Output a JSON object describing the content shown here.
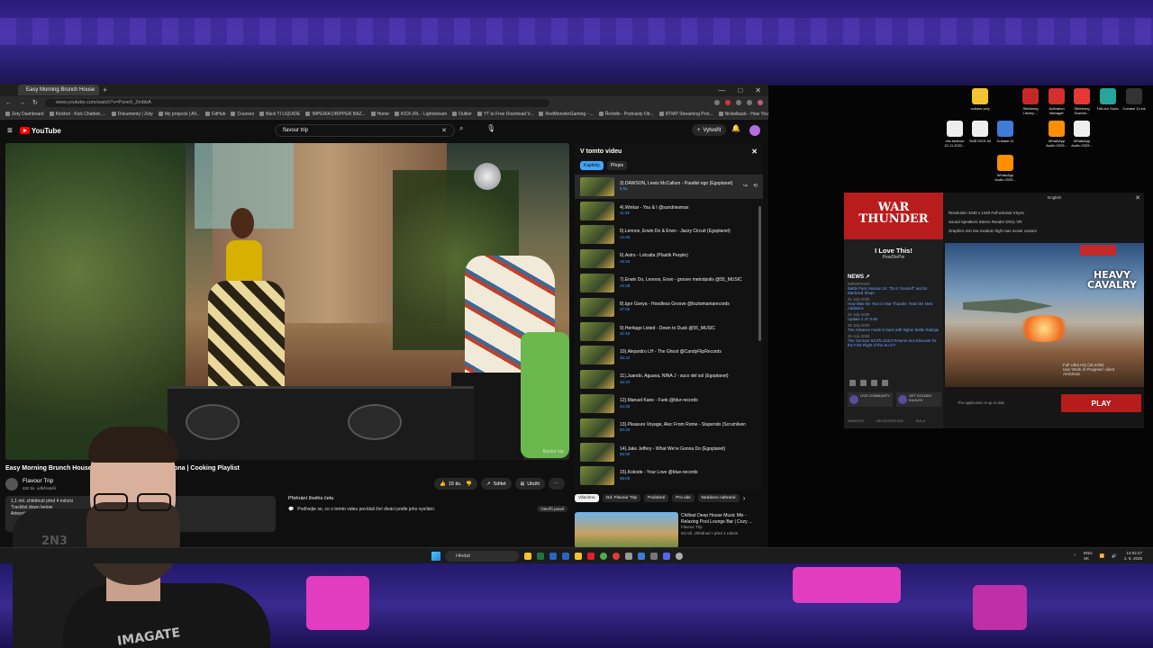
{
  "browser": {
    "tab_title": "Easy Morning Brunch House",
    "url": "www.youtube.com/watch?v=Psne9_ZmbbA",
    "bookmarks": [
      "Zety Dashboard",
      "Kickbot - Kick Chatbot, ...",
      "Dokumenty | Zety",
      "My projects | All...",
      "GitHub",
      "Courses",
      "Bäck TI LIQUIDE",
      "IMPERIA DRIPPER BAZ...",
      "Home",
      "KICK.IRL - Lightstream",
      "Outlier",
      "YT to Free Download V...",
      "RedMonsterGaming - ...",
      "Řešidlo - Podcasty Ob...",
      "RTMP Streaming Prot...",
      "Nickelback - How You ...",
      "Other Bookmarks"
    ]
  },
  "youtube": {
    "logo_text": "YouTube",
    "search_value": "flavour trip",
    "create_label": "Vytvořit",
    "video_title": "Easy Morning Brunch House Mix | Latin DJ Set In Barcelona | Cooking Playlist",
    "watermark": "flavour trip",
    "channel_name": "Flavour Trip",
    "channel_subs": "462 tis. odběratelů",
    "like_count": "15 tis.",
    "share_label": "Sdílet",
    "save_label": "Uložit",
    "description_line1": "1,1 mil. zhlédnutí  před 4 měsíci",
    "description_line2": "Tracklist down below",
    "description_line3": "Artwork...",
    "live_chat_title": "Přehrání živého četu",
    "live_chat_text": "Podívejte se, co o tomto videu povídali živí diváci podle jeho vysílání.",
    "live_chat_button": "Otevřít panel",
    "panel_title": "V tomto videu",
    "panel_tabs": [
      "Kapitoly",
      "Přepis"
    ],
    "chapters": [
      {
        "title": "3).DAWSON, Lewis McCallum - Parallel ego (Egoplanet)",
        "time": "8:51"
      },
      {
        "title": "4).Winkar - You & I @sundriesmax",
        "time": "11:45"
      },
      {
        "title": "5).Lennox, Erwin Do & Erwo - Jazzy Circuit (Egoplanet)",
        "time": "14:46"
      },
      {
        "title": "6).Astro - Lolcatta (Plastik People)",
        "time": "18:26"
      },
      {
        "title": "7).Erwin Do, Lennox, Erwo - groove metrolpolis @55_MUSIC",
        "time": "22:38"
      },
      {
        "title": "8).Igor Gonya - Hoodless Groove @lisztomaniarecords",
        "time": "27:00"
      },
      {
        "title": "9).Heritage Listed - Down to Dusk @55_MUSIC",
        "time": "31:53"
      },
      {
        "title": "10).Alejandro LH - The Ghost @CandyFlipRecords",
        "time": "35:22"
      },
      {
        "title": "11).Juando, Aguava, NINA J - suco del sol (Egoplanet)",
        "time": "40:43"
      },
      {
        "title": "12).Manuel Kane - Funk @blur-records",
        "time": "44:30"
      },
      {
        "title": "13).Pleasure Voyage, Alec From Rome - Stupendo (Scrumliversal)",
        "time": "50:20"
      },
      {
        "title": "14).Jake Jeffery - What We're Gonna Do (Egoplanet)",
        "time": "55:00"
      },
      {
        "title": "15).Kokode - Your Love @blue-records",
        "time": "58:00"
      }
    ],
    "chips": [
      "Všechno",
      "Od: Flavour Trip",
      "Podobné",
      "Pro vás",
      "Nedávno nahrané"
    ],
    "rec_title": "Chillout Deep House Music Mix - Relaxing Pool Lounge Bar | Cozy ...",
    "rec_channel": "Flavour Trip",
    "rec_meta": "53 mil. zhlédnutí • před 1 rokem"
  },
  "taskbar": {
    "search_placeholder": "Hledat",
    "lang": "ENG\nSK",
    "time": "14:02:47",
    "date": "2. 8. 2025"
  },
  "desktop_icons": [
    {
      "label": "cubase proj",
      "color": "#f4c430"
    },
    {
      "label": "Steinberg Library ...",
      "color": "#c62828"
    },
    {
      "label": "Activation Manager",
      "color": "#d32f2f"
    },
    {
      "label": "Steinberg Downlo...",
      "color": "#e53935"
    },
    {
      "label": "HALion Sonic",
      "color": "#26a69a"
    },
    {
      "label": "Cubase 11.lnk",
      "color": "#333333"
    },
    {
      "label": "mix fadeout 21.11.2022...",
      "color": "#eeeeee"
    },
    {
      "label": "SUB KICK.txt",
      "color": "#eeeeee"
    },
    {
      "label": "Cubase 11",
      "color": "#3f7bd8"
    },
    {
      "label": "WhatsApp Audio 2025...",
      "color": "#ff8f00"
    },
    {
      "label": "WhatsApp Audio 2025...",
      "color": "#eeeeee"
    },
    {
      "label": "WhatsApp Audio 2025...",
      "color": "#ff8f00"
    }
  ],
  "launcher": {
    "logo_line1": "WAR",
    "logo_line2": "THUNDER",
    "language": "English",
    "award_title": "I Love This!",
    "award_sub": "PewDiePie",
    "news_title": "NEWS ↗",
    "news": [
      {
        "date": "IMPORTANT",
        "text": "Battle Pass Season 24: \"Do It Yourself\" and its Warbond Shop!"
      },
      {
        "date": "31 July 2025",
        "text": "How Was the Year in War Thunder: Rate the New Additions"
      },
      {
        "date": "30 July 2025",
        "text": "Update 2.47.0.65"
      },
      {
        "date": "30 July 2025",
        "text": "The Advance mode is back with higher battle Ratings"
      },
      {
        "date": "29 July 2025",
        "text": "The German Sd.Kfz.234/4 Returns at a Discount for the First Flight of the Su-17!"
      }
    ],
    "settings_resolution": "Resolution  3440 x 1440   Full window   VSync",
    "settings_sound": "Sound   Speakers  Stereo   Render  DX11   VR",
    "settings_graphics": "Graphics   min   low   medium   high   max   movie   custom",
    "banner_line1": "HEAVY",
    "banner_line2": "CAVALRY",
    "res_label": "Full Ultra HQ (16.4GB)",
    "res_label2": "Use 'Work in Progress' client",
    "res_label3": "Anticheat",
    "badge1": "LIVE COMMUNITY",
    "badge2": "GET GOLDEN EAGLES",
    "status": "The application is up to date",
    "play_label": "PLAY",
    "links": [
      "WEBSITE",
      "REGISTRATION",
      "EULA"
    ]
  },
  "webcam": {
    "chair_text": "2N3",
    "shirt_text": "IMAGATE"
  }
}
